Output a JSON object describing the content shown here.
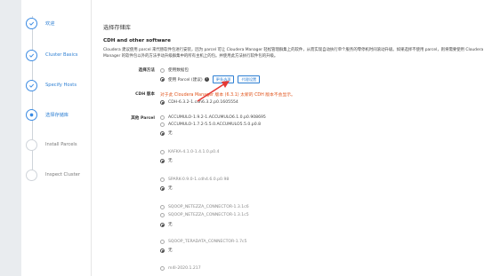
{
  "steps": [
    {
      "label": "欢迎",
      "state": "done"
    },
    {
      "label": "Cluster Basics",
      "state": "done"
    },
    {
      "label": "Specify Hosts",
      "state": "done"
    },
    {
      "label": "选择存储库",
      "state": "current"
    },
    {
      "label": "Install Parcels",
      "state": "todo"
    },
    {
      "label": "Inspect Cluster",
      "state": "todo"
    }
  ],
  "page": {
    "title": "选择存储库",
    "section_title": "CDH and other software",
    "description": "Cloudera 建议使用 parcel 来代替软件包进行安装，因为 parcel 可让 Cloudera Manager 轻松管理群集上的软件，从而实现自动执行单个服务的零停机时间滚动升级。如果选择不使用 parcel，则将需要使用 Cloudera Manager 的软件包以外的方法手动升级群集中的所有主机上的包。并使用此方法执行软件包的升级。"
  },
  "install_method": {
    "label": "选择方法",
    "options": [
      {
        "text": "使用数据包",
        "selected": false
      },
      {
        "text": "使用 Parcel (建议)",
        "selected": true
      }
    ],
    "more_options_button": "更多选项",
    "proxy_button": "代理设置"
  },
  "cdh_version": {
    "label": "CDH 版本",
    "warning": "对于此 Cloudera Manager 版本 (6.3.1) 太新的 CDH 版本不会显示。",
    "option": "CDH-6.3.2-1.cdh6.3.2.p0.1605554"
  },
  "other_parcels": {
    "label": "其他 Parcel",
    "groups": [
      {
        "options": [
          {
            "text": "ACCUMULO-1.9.2-1.ACCUMULO6.1.0.p0.908695",
            "selected": false
          },
          {
            "text": "ACCUMULO-1.7.2-5.5.0.ACCUMULO5.5.0.p0.8",
            "selected": false
          },
          {
            "text": "无",
            "selected": true
          }
        ]
      },
      {
        "options": [
          {
            "text": "KAFKA-4.1.0-1.4.1.0.p0.4",
            "selected": false
          },
          {
            "text": "无",
            "selected": true
          }
        ]
      },
      {
        "options": [
          {
            "text": "SPARK-0.9.0-1.cdh4.6.0.p0.98",
            "selected": false
          },
          {
            "text": "无",
            "selected": true
          }
        ]
      },
      {
        "options": [
          {
            "text": "SQOOP_NETEZZA_CONNECTOR-1.3.1c6",
            "selected": false
          },
          {
            "text": "SQOOP_NETEZZA_CONNECTOR-1.3.1c5",
            "selected": false
          },
          {
            "text": "无",
            "selected": true
          }
        ]
      },
      {
        "options": [
          {
            "text": "SQOOP_TERADATA_CONNECTOR-1.7c5",
            "selected": false
          },
          {
            "text": "无",
            "selected": true
          }
        ]
      },
      {
        "options": [
          {
            "text": "m4l-2020.1.217",
            "selected": false
          }
        ]
      }
    ]
  }
}
